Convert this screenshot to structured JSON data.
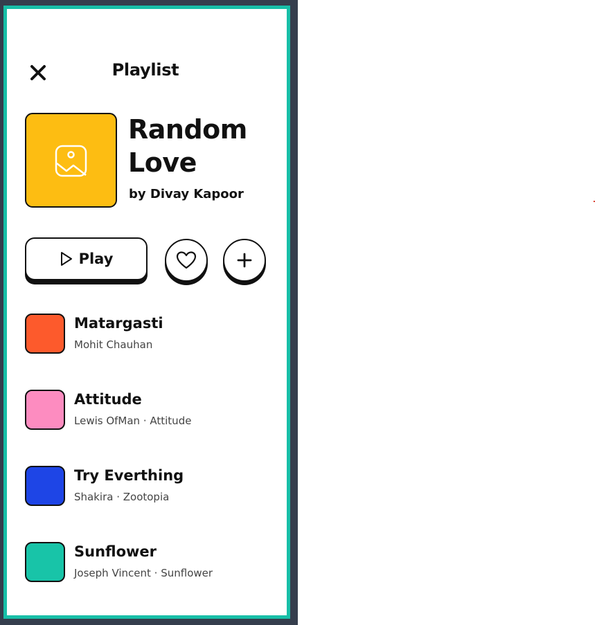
{
  "header": {
    "title": "Playlist",
    "close_icon": "close-icon"
  },
  "album": {
    "title": "Random Love",
    "artist": "by Divay Kapoor",
    "cover_color": "#fdbd12",
    "cover_icon": "image-placeholder-icon"
  },
  "actions": {
    "play_label": "Play",
    "play_icon": "play-icon",
    "like_icon": "heart-icon",
    "add_icon": "plus-icon"
  },
  "tracks": [
    {
      "title": "Matargasti",
      "subtitle": "Mohit Chauhan",
      "color": "#fd5a2c"
    },
    {
      "title": "Attitude",
      "subtitle": "Lewis OfMan · Attitude",
      "color": "#fd8cc0"
    },
    {
      "title": "Try Everthing",
      "subtitle": "Shakira · Zootopia",
      "color": "#1e45e6"
    },
    {
      "title": "Sunflower",
      "subtitle": "Joseph Vincent · Sunflower",
      "color": "#18c4a8"
    }
  ],
  "colors": {
    "frame": "#353e4d",
    "panel_border": "#18bfa8",
    "text": "#111111"
  }
}
